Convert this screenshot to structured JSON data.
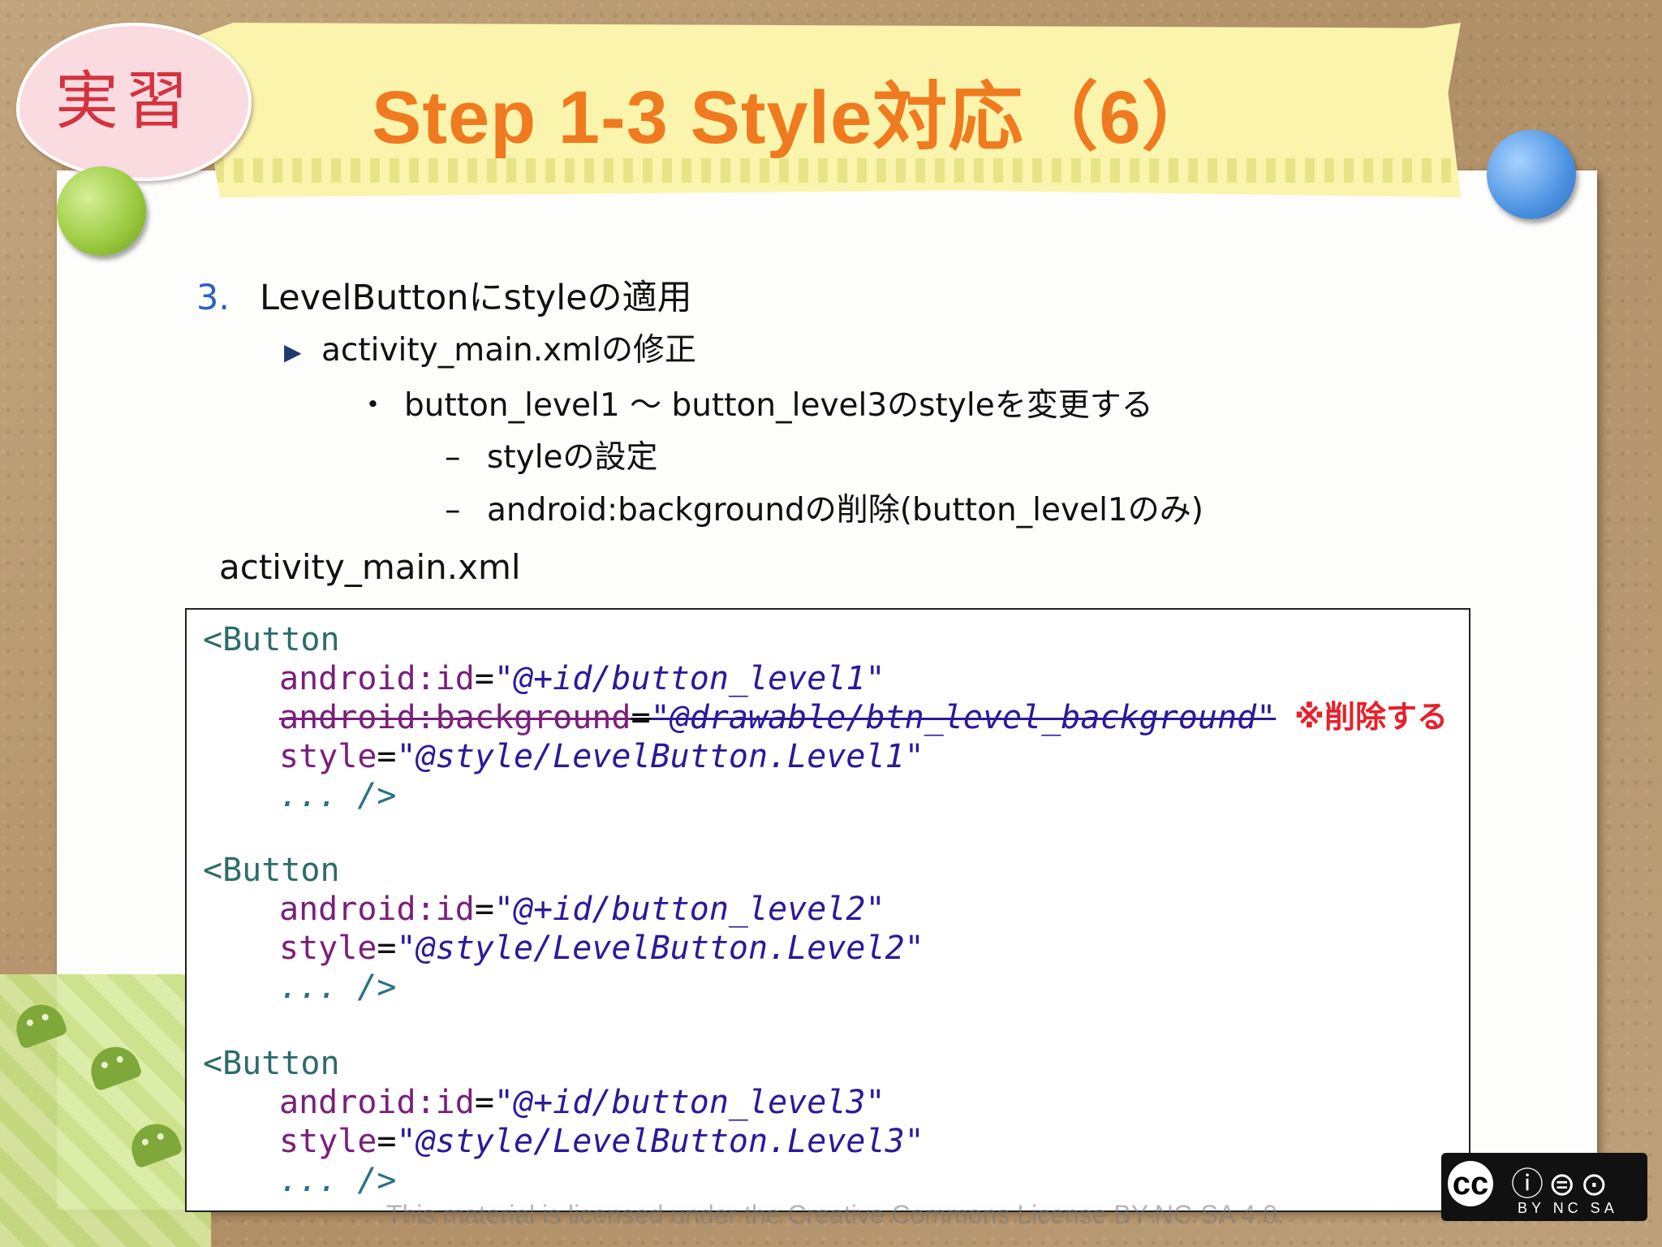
{
  "slide": {
    "title": "Step 1-3 Style対応（6）",
    "badge": "実習"
  },
  "outline": {
    "item1_num": "3.",
    "item1_text": "LevelButtonにstyleの適用",
    "item2_text": "activity_main.xmlの修正",
    "item3_bullet": "・",
    "item3_text": "button_level1 〜 button_level3のstyleを変更する",
    "item4_dash": "–",
    "item4_text": "styleの設定",
    "item5_dash": "–",
    "item5_text": "android:backgroundの削除(button_level1のみ)"
  },
  "code": {
    "filename": "activity_main.xml",
    "block1": {
      "tag": "<Button",
      "id_attr": "android:id",
      "id_val": "\"@+id/button_level1\"",
      "bg_attr": "android:background",
      "bg_val": "\"@drawable/btn_level_background\"",
      "style_attr": "style",
      "style_val": "\"@style/LevelButton.Level1\"",
      "close": "... />"
    },
    "block2": {
      "tag": "<Button",
      "id_attr": "android:id",
      "id_val": "\"@+id/button_level2\"",
      "style_attr": "style",
      "style_val": "\"@style/LevelButton.Level2\"",
      "close": "... />"
    },
    "block3": {
      "tag": "<Button",
      "id_attr": "android:id",
      "id_val": "\"@+id/button_level3\"",
      "style_attr": "style",
      "style_val": "\"@style/LevelButton.Level3\"",
      "close": "... />"
    },
    "equals": "=",
    "delete_note": "※削除する"
  },
  "footer": {
    "license_text": "This material is licensed under the Creative Commons License BY-NC-SA 4.0.",
    "cc_main": "cc",
    "cc_labels": "BY  NC  SA"
  },
  "colors": {
    "title": "#f07a1f",
    "delete_note": "#e8202a",
    "list_number": "#2c5fc4"
  }
}
